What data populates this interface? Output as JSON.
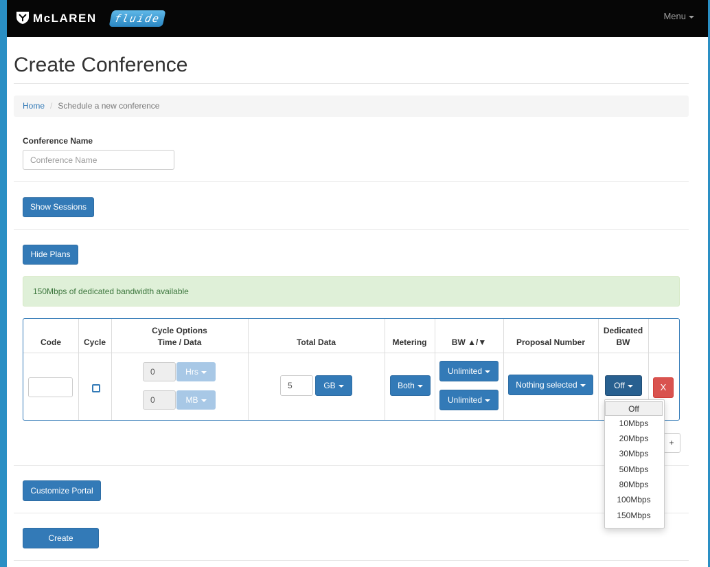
{
  "nav": {
    "brand": "McLAREN",
    "product": "fluide",
    "menu_label": "Menu"
  },
  "page": {
    "title": "Create Conference"
  },
  "breadcrumb": {
    "home": "Home",
    "separator": "/",
    "current": "Schedule a new conference"
  },
  "conference_name": {
    "label": "Conference Name",
    "placeholder": "Conference Name",
    "value": ""
  },
  "buttons": {
    "show_sessions": "Show Sessions",
    "hide_plans": "Hide Plans",
    "customize_portal": "Customize Portal",
    "create": "Create",
    "add_row": "+",
    "remove_row": "X"
  },
  "alert": {
    "text": "150Mbps of dedicated bandwidth available",
    "color": "#dff0d8"
  },
  "table": {
    "headers": {
      "code": "Code",
      "cycle": "Cycle",
      "cycle_options_1": "Cycle Options",
      "cycle_options_2": "Time / Data",
      "total_data": "Total Data",
      "metering": "Metering",
      "bw": "BW ▲/▼",
      "proposal_number": "Proposal Number",
      "dedicated_1": "Dedicated",
      "dedicated_2": "BW"
    },
    "row": {
      "code": "",
      "cycle_checked": false,
      "time_value": "0",
      "time_unit": "Hrs",
      "data_value": "0",
      "data_unit": "MB",
      "total_data_value": "5",
      "total_data_unit": "GB",
      "metering": "Both",
      "bw_up": "Unlimited",
      "bw_down": "Unlimited",
      "proposal": "Nothing selected",
      "dedicated_bw": "Off"
    }
  },
  "dedicated_bw_options": [
    "Off",
    "10Mbps",
    "20Mbps",
    "30Mbps",
    "50Mbps",
    "80Mbps",
    "100Mbps",
    "150Mbps"
  ],
  "colors": {
    "primary": "#337ab7",
    "danger": "#d9534f",
    "navbar": "#060606"
  }
}
